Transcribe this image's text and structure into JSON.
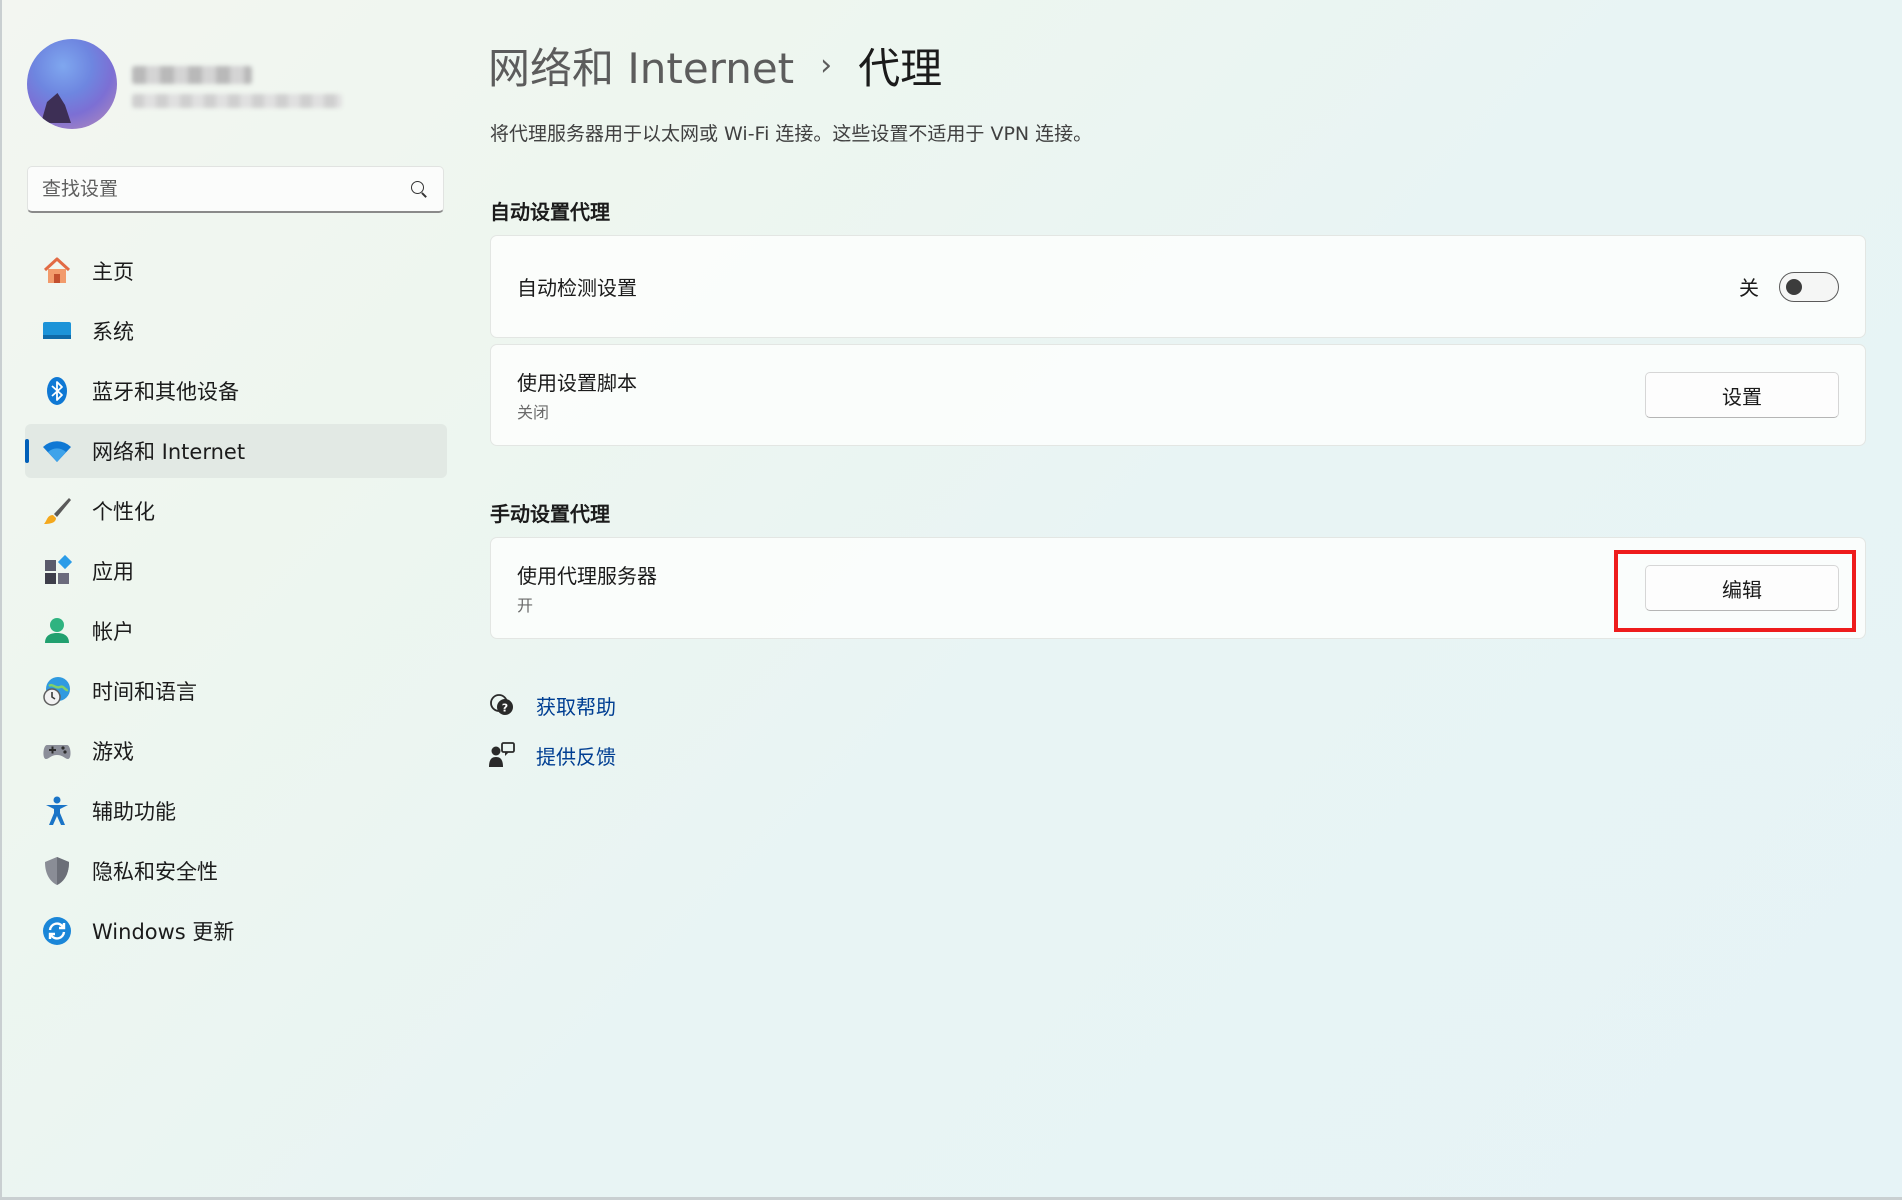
{
  "user": {
    "name": "",
    "email": ""
  },
  "search": {
    "placeholder": "查找设置"
  },
  "sidebar": {
    "items": [
      {
        "label": "主页",
        "icon": "home-icon"
      },
      {
        "label": "系统",
        "icon": "system-icon"
      },
      {
        "label": "蓝牙和其他设备",
        "icon": "bluetooth-icon"
      },
      {
        "label": "网络和 Internet",
        "icon": "wifi-icon",
        "active": true
      },
      {
        "label": "个性化",
        "icon": "brush-icon"
      },
      {
        "label": "应用",
        "icon": "apps-icon"
      },
      {
        "label": "帐户",
        "icon": "account-icon"
      },
      {
        "label": "时间和语言",
        "icon": "globe-clock-icon"
      },
      {
        "label": "游戏",
        "icon": "gamepad-icon"
      },
      {
        "label": "辅助功能",
        "icon": "accessibility-icon"
      },
      {
        "label": "隐私和安全性",
        "icon": "shield-icon"
      },
      {
        "label": "Windows 更新",
        "icon": "update-icon"
      }
    ]
  },
  "header": {
    "parent": "网络和 Internet",
    "separator": "›",
    "current": "代理"
  },
  "description": "将代理服务器用于以太网或 Wi-Fi 连接。这些设置不适用于 VPN 连接。",
  "auto_proxy": {
    "title": "自动设置代理",
    "detect": {
      "label": "自动检测设置",
      "state_label": "关",
      "enabled": false
    },
    "script": {
      "label": "使用设置脚本",
      "status": "关闭",
      "button": "设置"
    }
  },
  "manual_proxy": {
    "title": "手动设置代理",
    "server": {
      "label": "使用代理服务器",
      "status": "开",
      "button": "编辑"
    }
  },
  "help": {
    "get_help": "获取帮助",
    "feedback": "提供反馈"
  },
  "colors": {
    "accent": "#005fb8",
    "link": "#003e92",
    "highlight": "#ee1c1c"
  }
}
